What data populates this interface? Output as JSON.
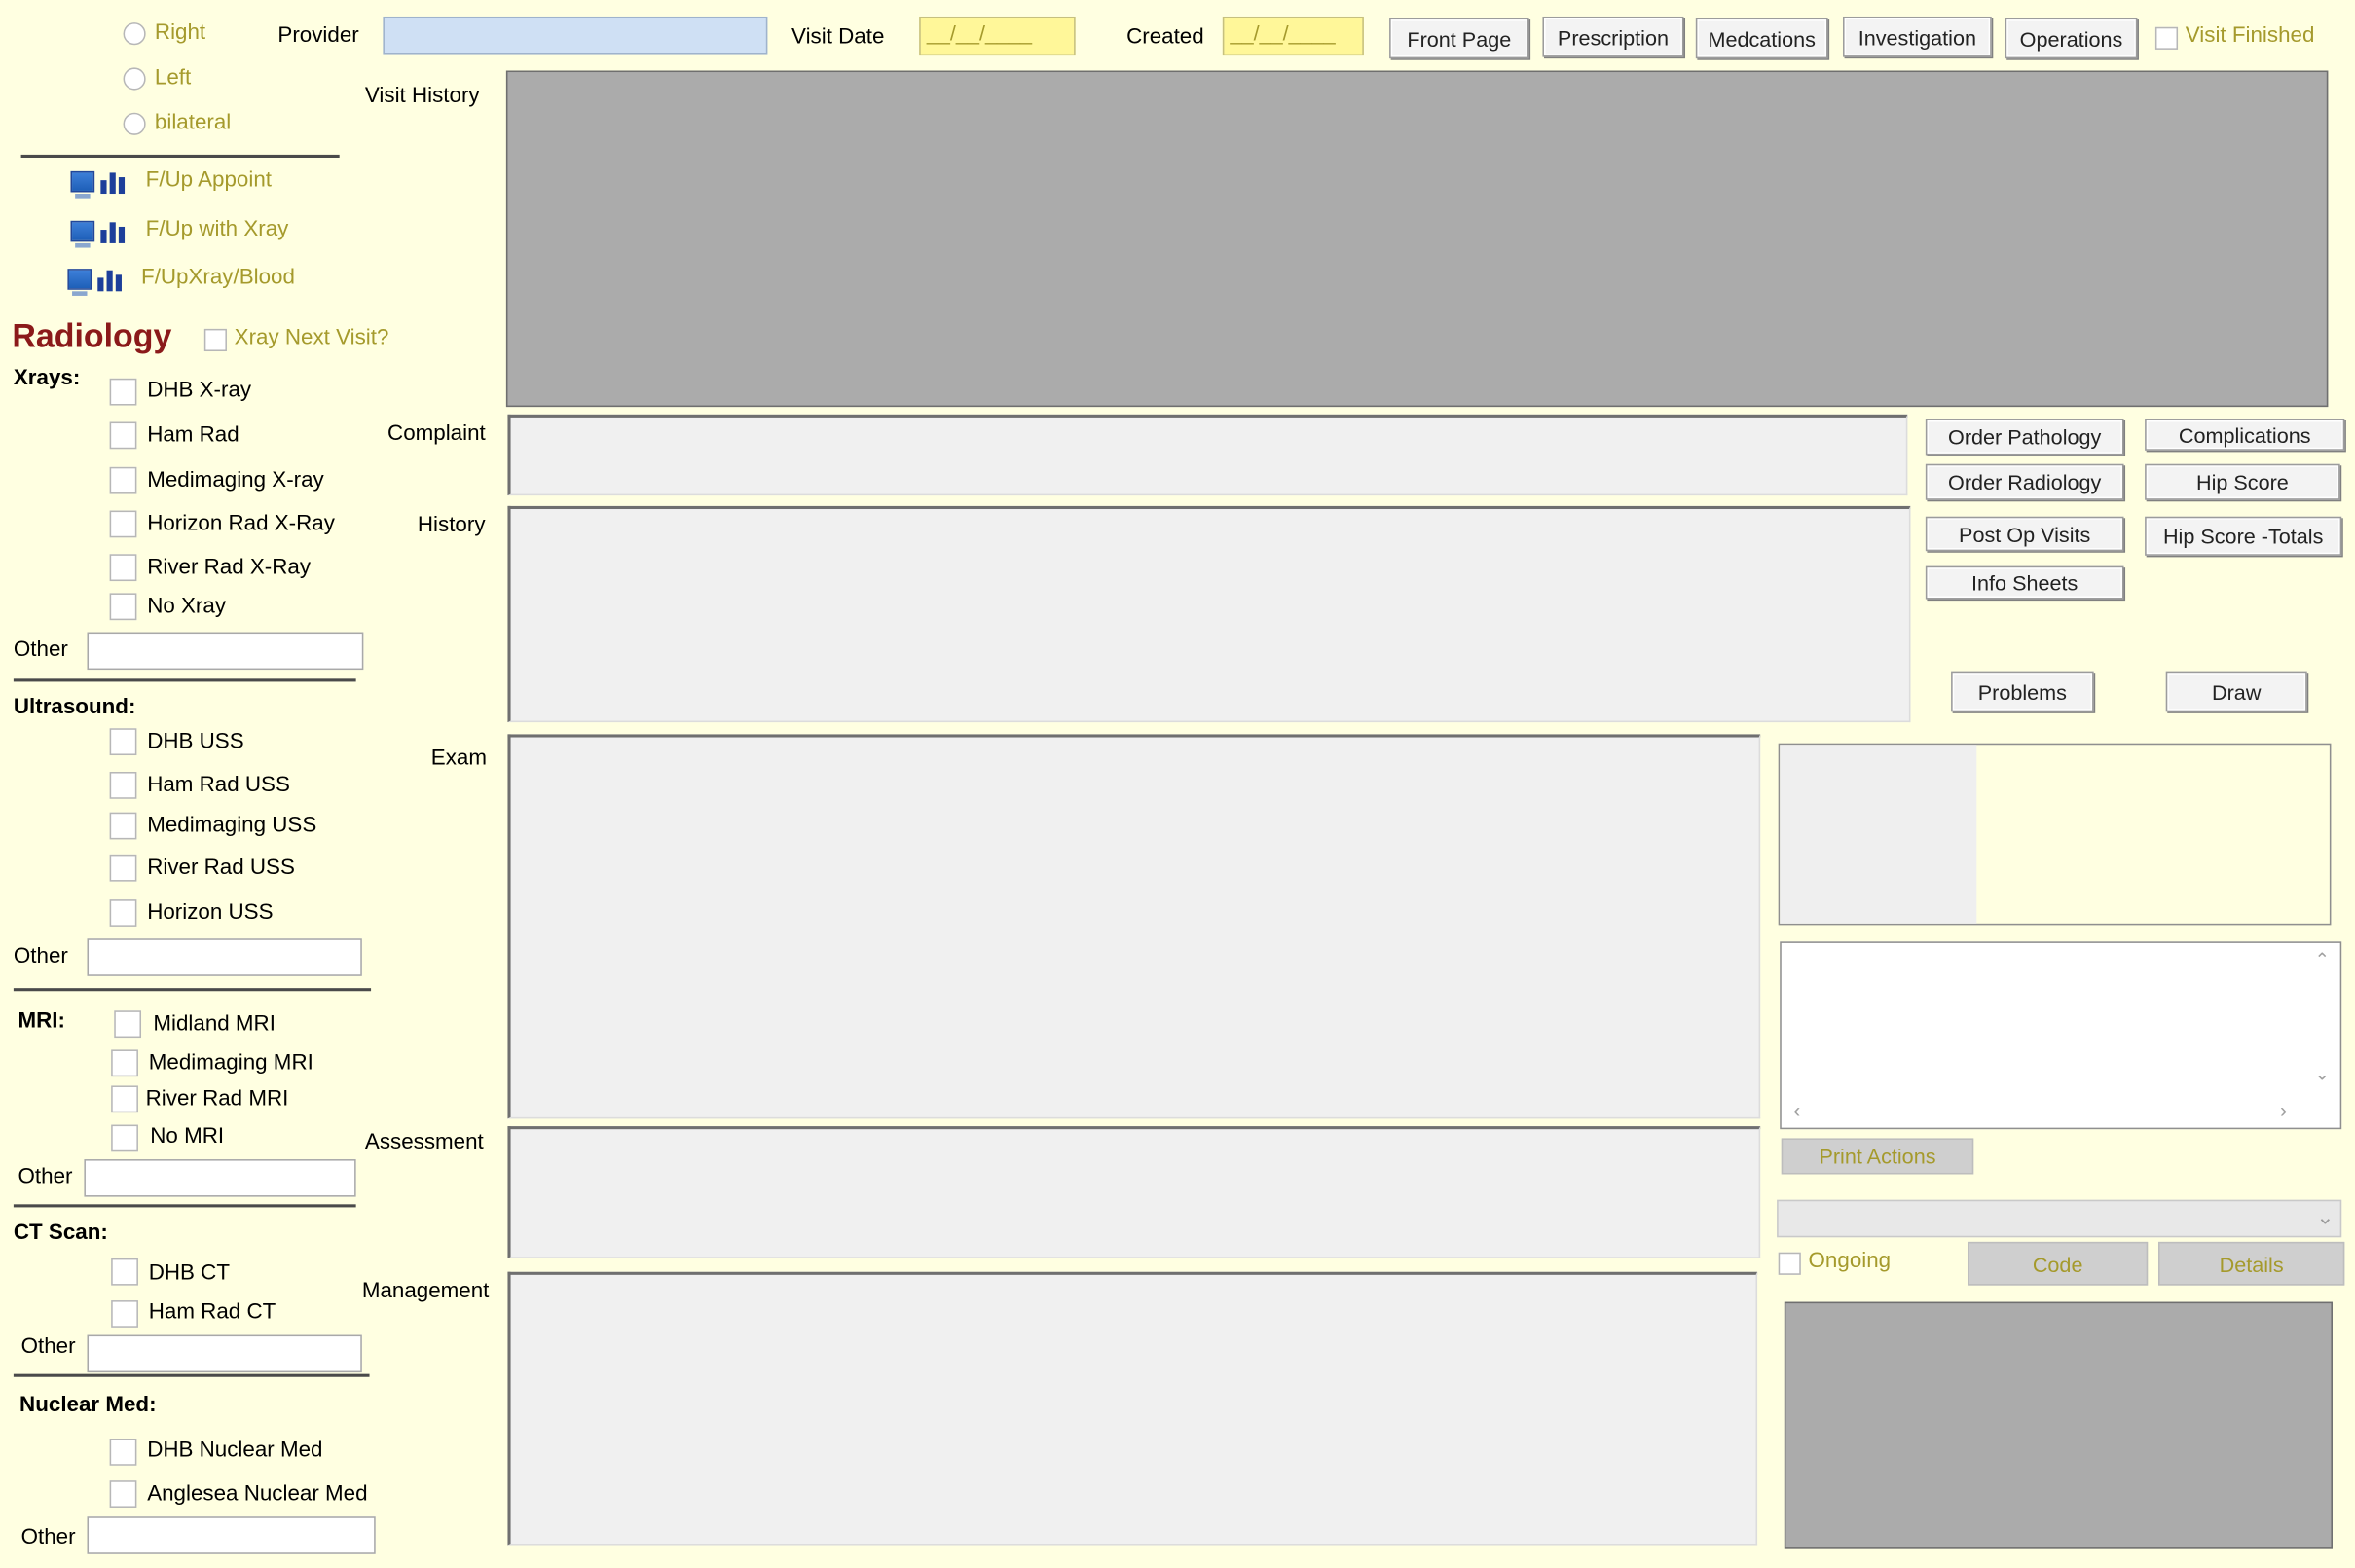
{
  "side": {
    "options": [
      "Right",
      "Left",
      "bilateral"
    ]
  },
  "header": {
    "provider_label": "Provider",
    "provider_value": "",
    "visit_date_label": "Visit Date",
    "visit_date_value": "__/__/____",
    "created_label": "Created",
    "created_value": "__/__/____",
    "nav_buttons": [
      "Front Page",
      "Prescription",
      "Medcations",
      "Investigation",
      "Operations"
    ],
    "visit_finished_label": "Visit Finished"
  },
  "followups": [
    "F/Up Appoint",
    "F/Up with Xray",
    "F/UpXray/Blood"
  ],
  "radiology": {
    "title": "Radiology",
    "xray_next_visit_label": "Xray Next Visit?",
    "xrays": {
      "heading": "Xrays:",
      "items": [
        "DHB X-ray",
        "Ham Rad",
        "Medimaging  X-ray",
        "Horizon Rad X-Ray",
        "River Rad X-Ray",
        "No Xray"
      ],
      "other_label": "Other",
      "other_value": ""
    },
    "ultrasound": {
      "heading": "Ultrasound:",
      "items": [
        "DHB USS",
        "Ham Rad USS",
        "Medimaging USS",
        "River Rad USS",
        "Horizon USS"
      ],
      "other_label": "Other",
      "other_value": ""
    },
    "mri": {
      "heading": "MRI:",
      "items": [
        "Midland MRI",
        "Medimaging MRI",
        "River Rad MRI",
        "No MRI"
      ],
      "other_label": "Other",
      "other_value": ""
    },
    "ct": {
      "heading": "CT Scan:",
      "items": [
        "DHB CT",
        "Ham Rad CT"
      ],
      "other_label": "Other",
      "other_value": ""
    },
    "nuclear": {
      "heading": "Nuclear Med:",
      "items": [
        "DHB Nuclear Med",
        "Anglesea Nuclear Med"
      ],
      "other_label": "Other",
      "other_value": ""
    }
  },
  "sections": {
    "visit_history": "Visit History",
    "complaint": "Complaint",
    "history": "History",
    "exam": "Exam",
    "assessment": "Assessment",
    "management": "Management"
  },
  "actions": {
    "order_pathology": "Order Pathology",
    "complications": "Complications",
    "order_radiology": "Order Radiology",
    "hip_score": "Hip Score",
    "post_op_visits": "Post Op Visits",
    "hip_score_totals": "Hip Score -Totals",
    "info_sheets": "Info Sheets",
    "problems": "Problems",
    "draw": "Draw",
    "print_actions": "Print Actions",
    "ongoing_label": "Ongoing",
    "code": "Code",
    "details": "Details"
  },
  "colors": {
    "background": "#ffffe1",
    "date_field": "#fff799",
    "accent_text": "#a59a2c",
    "radiology_title": "#8b1a1a",
    "grey_panel": "#ababab"
  }
}
